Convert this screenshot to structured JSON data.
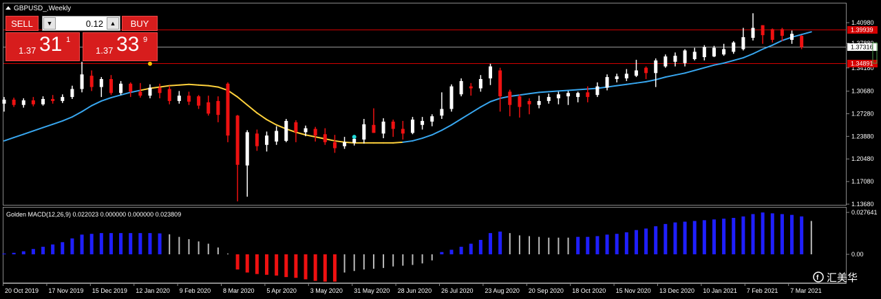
{
  "window": {
    "title": "GBPUSD_,Weekly"
  },
  "trade_panel": {
    "sell_label": "SELL",
    "buy_label": "BUY",
    "lot_value": "0.12",
    "bid": {
      "small": "1.37",
      "big": "31",
      "sup": "1"
    },
    "ask": {
      "small": "1.37",
      "big": "33",
      "sup": "9"
    },
    "sell_color": "#d71d1d"
  },
  "price_axis": {
    "ticks": [
      "1.40980",
      "1.37880",
      "1.34180",
      "1.30680",
      "1.27280",
      "1.23880",
      "1.20480",
      "1.17080",
      "1.13680"
    ],
    "tags": {
      "upper": "1.39939",
      "current": "1.37316",
      "lower": "1.34891"
    }
  },
  "indicator": {
    "label": "Golden MACD(12,26,9) 0.022023 0.000000 0.000000 0.023809",
    "axis_ticks": [
      "0.027641",
      "0.00"
    ]
  },
  "time_axis": [
    "20 Oct 2019",
    "17 Nov 2019",
    "15 Dec 2019",
    "12 Jan 2020",
    "9 Feb 2020",
    "8 Mar 2020",
    "5 Apr 2020",
    "3 May 2020",
    "31 May 2020",
    "28 Jun 2020",
    "26 Jul 2020",
    "23 Aug 2020",
    "20 Sep 2020",
    "18 Oct 2020",
    "15 Nov 2020",
    "13 Dec 2020",
    "10 Jan 2021",
    "7 Feb 2021",
    "7 Mar 2021"
  ],
  "watermark": {
    "text": "汇美华"
  },
  "colors": {
    "bull": "#ffffff",
    "bear": "#ee1111",
    "ma_up": "#38a7f0",
    "ma_flat": "#ffd23c",
    "macd_up": "#1f1fff",
    "macd_down": "#ee1111",
    "macd_flat": "#bdbdbd",
    "grid_line": "#d40000"
  },
  "chart_data": {
    "type": "candlestick",
    "candles": [
      [
        1.288,
        1.298,
        1.276,
        1.294
      ],
      [
        1.294,
        1.297,
        1.283,
        1.286
      ],
      [
        1.286,
        1.296,
        1.282,
        1.293
      ],
      [
        1.293,
        1.298,
        1.284,
        1.287
      ],
      [
        1.287,
        1.299,
        1.285,
        1.295
      ],
      [
        1.295,
        1.301,
        1.288,
        1.292
      ],
      [
        1.292,
        1.302,
        1.289,
        1.298
      ],
      [
        1.298,
        1.315,
        1.295,
        1.31
      ],
      [
        1.31,
        1.351,
        1.305,
        1.332
      ],
      [
        1.33,
        1.338,
        1.307,
        1.313
      ],
      [
        1.313,
        1.328,
        1.298,
        1.325
      ],
      [
        1.325,
        1.331,
        1.301,
        1.304
      ],
      [
        1.304,
        1.322,
        1.301,
        1.318
      ],
      [
        1.318,
        1.32,
        1.298,
        1.306
      ],
      [
        1.306,
        1.319,
        1.297,
        1.3
      ],
      [
        1.3,
        1.317,
        1.296,
        1.312
      ],
      [
        1.312,
        1.318,
        1.296,
        1.304
      ],
      [
        1.31,
        1.315,
        1.287,
        1.292
      ],
      [
        1.292,
        1.307,
        1.288,
        1.3
      ],
      [
        1.3,
        1.306,
        1.286,
        1.291
      ],
      [
        1.299,
        1.301,
        1.28,
        1.285
      ],
      [
        1.29,
        1.3,
        1.27,
        1.273
      ],
      [
        1.292,
        1.299,
        1.26,
        1.271
      ],
      [
        1.318,
        1.32,
        1.23,
        1.24
      ],
      [
        1.27,
        1.271,
        1.141,
        1.196
      ],
      [
        1.195,
        1.248,
        1.148,
        1.245
      ],
      [
        1.243,
        1.249,
        1.217,
        1.224
      ],
      [
        1.226,
        1.246,
        1.216,
        1.24
      ],
      [
        1.231,
        1.254,
        1.226,
        1.247
      ],
      [
        1.232,
        1.265,
        1.23,
        1.262
      ],
      [
        1.26,
        1.263,
        1.23,
        1.245
      ],
      [
        1.245,
        1.255,
        1.239,
        1.251
      ],
      [
        1.25,
        1.253,
        1.231,
        1.24
      ],
      [
        1.242,
        1.251,
        1.226,
        1.23
      ],
      [
        1.23,
        1.241,
        1.214,
        1.221
      ],
      [
        1.224,
        1.238,
        1.22,
        1.23
      ],
      [
        1.229,
        1.236,
        1.225,
        1.235
      ],
      [
        1.234,
        1.265,
        1.228,
        1.257
      ],
      [
        1.256,
        1.281,
        1.244,
        1.244
      ],
      [
        1.243,
        1.266,
        1.236,
        1.261
      ],
      [
        1.261,
        1.264,
        1.238,
        1.25
      ],
      [
        1.25,
        1.262,
        1.234,
        1.243
      ],
      [
        1.244,
        1.268,
        1.242,
        1.264
      ],
      [
        1.256,
        1.268,
        1.249,
        1.262
      ],
      [
        1.261,
        1.272,
        1.254,
        1.269
      ],
      [
        1.27,
        1.305,
        1.265,
        1.28
      ],
      [
        1.28,
        1.317,
        1.276,
        1.314
      ],
      [
        1.302,
        1.326,
        1.299,
        1.322
      ],
      [
        1.314,
        1.319,
        1.3,
        1.311
      ],
      [
        1.311,
        1.331,
        1.306,
        1.325
      ],
      [
        1.326,
        1.348,
        1.316,
        1.344
      ],
      [
        1.338,
        1.342,
        1.276,
        1.299
      ],
      [
        1.306,
        1.309,
        1.269,
        1.286
      ],
      [
        1.299,
        1.302,
        1.267,
        1.283
      ],
      [
        1.292,
        1.296,
        1.272,
        1.287
      ],
      [
        1.286,
        1.3,
        1.281,
        1.292
      ],
      [
        1.292,
        1.303,
        1.288,
        1.298
      ],
      [
        1.296,
        1.306,
        1.287,
        1.302
      ],
      [
        1.299,
        1.307,
        1.286,
        1.304
      ],
      [
        1.298,
        1.306,
        1.29,
        1.304
      ],
      [
        1.305,
        1.314,
        1.29,
        1.298
      ],
      [
        1.301,
        1.32,
        1.298,
        1.314
      ],
      [
        1.312,
        1.332,
        1.308,
        1.328
      ],
      [
        1.325,
        1.333,
        1.32,
        1.329
      ],
      [
        1.326,
        1.34,
        1.322,
        1.333
      ],
      [
        1.33,
        1.354,
        1.328,
        1.338
      ],
      [
        1.342,
        1.344,
        1.325,
        1.334
      ],
      [
        1.334,
        1.356,
        1.313,
        1.353
      ],
      [
        1.344,
        1.362,
        1.342,
        1.359
      ],
      [
        1.351,
        1.365,
        1.344,
        1.36
      ],
      [
        1.349,
        1.37,
        1.344,
        1.368
      ],
      [
        1.355,
        1.372,
        1.353,
        1.366
      ],
      [
        1.358,
        1.376,
        1.353,
        1.373
      ],
      [
        1.359,
        1.375,
        1.358,
        1.372
      ],
      [
        1.362,
        1.378,
        1.36,
        1.37
      ],
      [
        1.366,
        1.382,
        1.363,
        1.38
      ],
      [
        1.37,
        1.402,
        1.368,
        1.388
      ],
      [
        1.387,
        1.424,
        1.383,
        1.402
      ],
      [
        1.406,
        1.406,
        1.378,
        1.391
      ],
      [
        1.4,
        1.401,
        1.38,
        1.384
      ],
      [
        1.4,
        1.402,
        1.382,
        1.39
      ],
      [
        1.384,
        1.398,
        1.378,
        1.393
      ],
      [
        1.39,
        1.391,
        1.37,
        1.373
      ]
    ],
    "ma": [
      1.232,
      1.237,
      1.242,
      1.247,
      1.252,
      1.257,
      1.262,
      1.268,
      1.276,
      1.285,
      1.292,
      1.297,
      1.301,
      1.305,
      1.308,
      1.311,
      1.313,
      1.315,
      1.316,
      1.317,
      1.316,
      1.315,
      1.313,
      1.308,
      1.298,
      1.286,
      1.274,
      1.264,
      1.256,
      1.25,
      1.245,
      1.241,
      1.238,
      1.235,
      1.232,
      1.23,
      1.229,
      1.229,
      1.229,
      1.229,
      1.229,
      1.23,
      1.232,
      1.236,
      1.241,
      1.248,
      1.256,
      1.265,
      1.274,
      1.283,
      1.291,
      1.296,
      1.299,
      1.301,
      1.303,
      1.305,
      1.306,
      1.307,
      1.308,
      1.309,
      1.31,
      1.311,
      1.313,
      1.315,
      1.317,
      1.319,
      1.321,
      1.324,
      1.328,
      1.331,
      1.334,
      1.338,
      1.342,
      1.346,
      1.349,
      1.353,
      1.357,
      1.363,
      1.37,
      1.376,
      1.383,
      1.388,
      1.392,
      1.396
    ],
    "ma_flat_range": [
      14,
      41
    ],
    "macd": [
      0.0005,
      0.001,
      0.002,
      0.0035,
      0.005,
      0.0065,
      0.008,
      0.0105,
      0.013,
      0.0135,
      0.014,
      0.014,
      0.014,
      0.014,
      0.014,
      0.014,
      0.0138,
      0.0132,
      0.0115,
      0.01,
      0.0085,
      0.007,
      0.0045,
      0.0005,
      -0.01,
      -0.012,
      -0.013,
      -0.0135,
      -0.014,
      -0.015,
      -0.0155,
      -0.0165,
      -0.0175,
      -0.018,
      -0.018,
      -0.012,
      -0.011,
      -0.01,
      -0.0095,
      -0.009,
      -0.008,
      -0.0075,
      -0.007,
      -0.006,
      -0.004,
      0.0015,
      0.003,
      0.005,
      0.007,
      0.0095,
      0.014,
      0.015,
      0.014,
      0.0125,
      0.012,
      0.0115,
      0.011,
      0.011,
      0.011,
      0.0115,
      0.0115,
      0.012,
      0.013,
      0.0135,
      0.0145,
      0.016,
      0.017,
      0.0185,
      0.02,
      0.021,
      0.0215,
      0.022,
      0.0225,
      0.023,
      0.0235,
      0.024,
      0.025,
      0.0265,
      0.0276,
      0.027,
      0.0265,
      0.026,
      0.025,
      0.022
    ],
    "macd_flat": [
      17,
      18,
      19,
      20,
      21,
      22,
      23,
      35,
      36,
      37,
      38,
      39,
      40,
      41,
      42,
      43,
      44,
      52,
      53,
      54,
      55,
      56,
      57,
      58,
      83
    ],
    "markers": [
      {
        "index": 15,
        "value": 1.348,
        "color": "#ffc000"
      },
      {
        "index": 36,
        "value": 1.238,
        "color": "#22d8d8"
      }
    ],
    "hlines": {
      "upper": 1.39939,
      "current": 1.37316,
      "lower": 1.34891
    }
  }
}
